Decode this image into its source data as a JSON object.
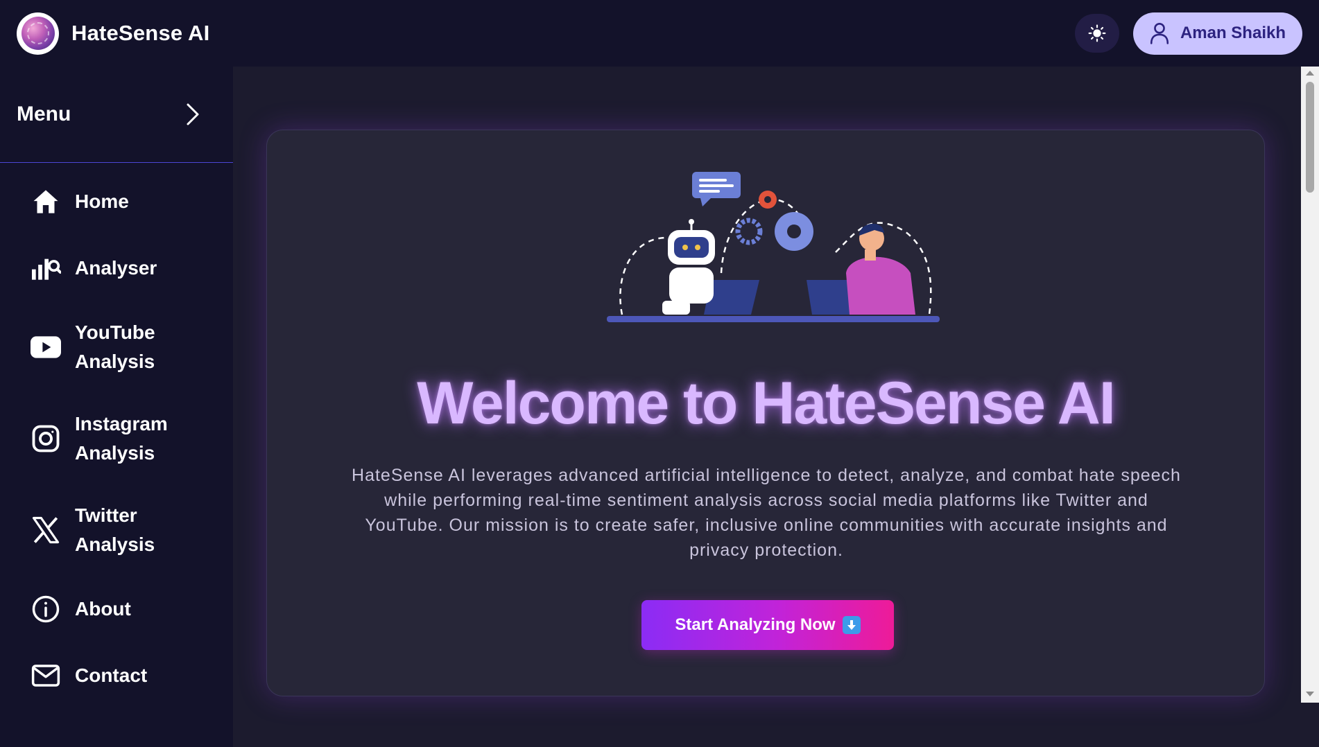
{
  "header": {
    "brand_name": "HateSense AI",
    "user_name": "Aman Shaikh",
    "icons": {
      "logo": "brain-logo-icon",
      "theme": "sun-icon",
      "user": "user-icon"
    }
  },
  "sidebar": {
    "menu_title": "Menu",
    "items": [
      {
        "label": "Home",
        "icon": "home-icon"
      },
      {
        "label": "Analyser",
        "icon": "bar-chart-search-icon"
      },
      {
        "label": "YouTube Analysis",
        "icon": "youtube-icon"
      },
      {
        "label": "Instagram Analysis",
        "icon": "instagram-icon"
      },
      {
        "label": "Twitter Analysis",
        "icon": "x-twitter-icon"
      },
      {
        "label": "About",
        "icon": "info-icon"
      },
      {
        "label": "Contact",
        "icon": "mail-icon"
      }
    ]
  },
  "hero": {
    "title": "Welcome to HateSense AI",
    "description": "HateSense AI leverages advanced artificial intelligence to detect, analyze, and combat hate speech while performing real-time sentiment analysis across social media platforms like Twitter and YouTube. Our mission is to create safer, inclusive online communities with accurate insights and privacy protection.",
    "cta_label": "Start Analyzing Now",
    "cta_emoji": "down-arrow-emoji-icon",
    "illustration": "robot-and-human-working-illustration"
  },
  "colors": {
    "header_bg": "#13122a",
    "sidebar_bg": "#13122a",
    "main_bg": "#1c1b2e",
    "card_bg": "#272638",
    "accent_title": "#d9b8ff",
    "user_button_bg": "#c9c3ff",
    "cta_gradient_start": "#8b2cf5",
    "cta_gradient_end": "#ee1b98"
  }
}
